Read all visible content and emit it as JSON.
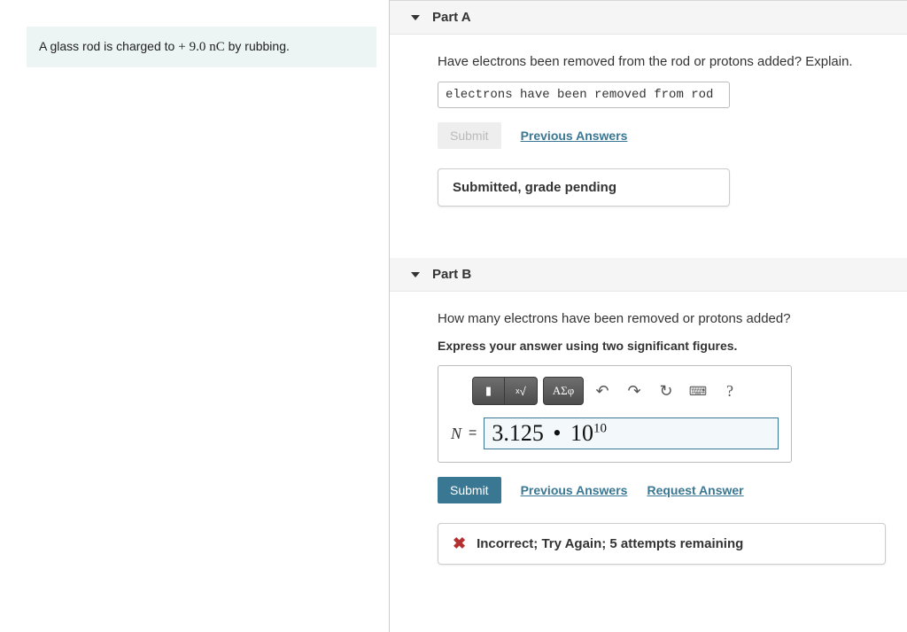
{
  "problem": {
    "prefix": "A glass rod is charged to ",
    "sign": "+",
    "value": "9.0",
    "unit": "nC",
    "suffix": " by rubbing."
  },
  "partA": {
    "title": "Part A",
    "question": "Have electrons been removed from the rod or protons added? Explain.",
    "answer": "electrons have been removed from rod",
    "submit_label": "Submit",
    "prev_label": "Previous Answers",
    "status": "Submitted, grade pending"
  },
  "partB": {
    "title": "Part B",
    "question": "How many electrons have been removed or protons added?",
    "instruction": "Express your answer using two significant figures.",
    "toolbar": {
      "template_label": "▮",
      "radical_label": "√",
      "greek_label": "ΑΣφ",
      "undo_label": "↶",
      "redo_label": "↷",
      "reset_label": "↻",
      "keyboard_label": "⌨",
      "help_label": "?"
    },
    "var_label": "N",
    "eq_sign": "=",
    "answer_base": "3.125",
    "answer_dot": "•",
    "answer_ten": "10",
    "answer_exp": "10",
    "submit_label": "Submit",
    "prev_label": "Previous Answers",
    "request_label": "Request Answer",
    "status": "Incorrect; Try Again; 5 attempts remaining",
    "x_glyph": "✖"
  }
}
